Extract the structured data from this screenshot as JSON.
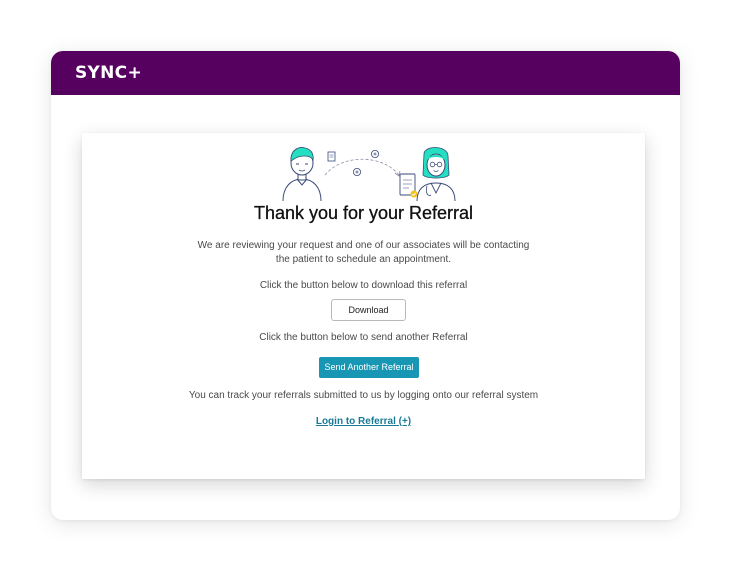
{
  "header": {
    "brand": "SYNC+",
    "background_color": "#560060"
  },
  "card": {
    "illustration": "referral-handoff-illustration",
    "title": "Thank you for your Referral",
    "review_message_line1": "We are reviewing your request and one of our associates will be contacting",
    "review_message_line2": "the patient to schedule an appointment.",
    "download_prompt": "Click the button below to download this referral",
    "download_label": "Download",
    "send_prompt": "Click the button below to send another Referral",
    "send_label": "Send Another Referral",
    "track_message": "You can track your referrals submitted to us by logging onto our referral system",
    "login_link": "Login to Referral (+)",
    "accent_color": "#1797b3"
  }
}
